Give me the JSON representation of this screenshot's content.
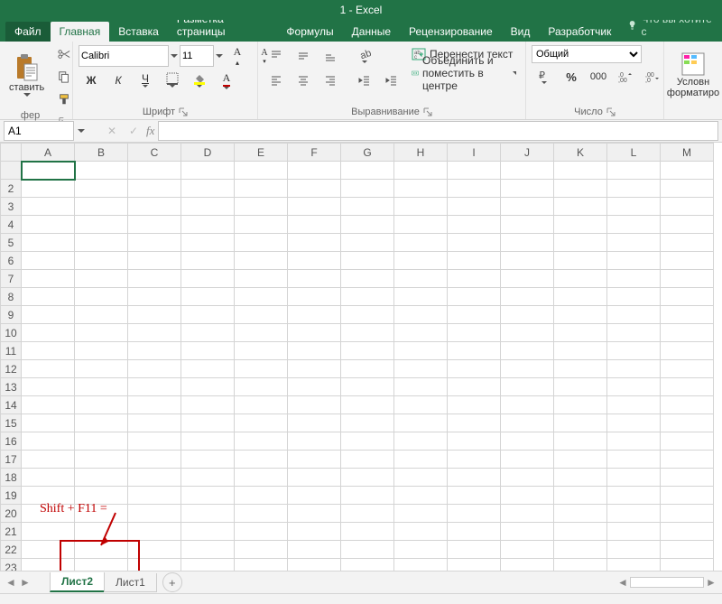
{
  "title": "1 - Excel",
  "tabs": {
    "file": "Файл",
    "home": "Главная",
    "insert": "Вставка",
    "pagelayout": "Разметка страницы",
    "formulas": "Формулы",
    "data": "Данные",
    "review": "Рецензирование",
    "view": "Вид",
    "developer": "Разработчик"
  },
  "tell_me": "Что вы хотите с",
  "ribbon": {
    "clipboard": {
      "paste": "ставить",
      "label": "фер обмена"
    },
    "font": {
      "name": "Calibri",
      "size": "11",
      "label": "Шрифт"
    },
    "alignment": {
      "wrap": "Перенести текст",
      "merge": "Объединить и поместить в центре",
      "label": "Выравнивание"
    },
    "number": {
      "format": "Общий",
      "label": "Число"
    },
    "styles": {
      "condfmt": "Условн",
      "condfmt2": "форматиро"
    }
  },
  "namebox": "A1",
  "columns": [
    "A",
    "B",
    "C",
    "D",
    "E",
    "F",
    "G",
    "H",
    "I",
    "J",
    "K",
    "L",
    "M"
  ],
  "annotation": "Shift + F11 =",
  "sheets": {
    "active": "Лист2",
    "other": "Лист1"
  }
}
